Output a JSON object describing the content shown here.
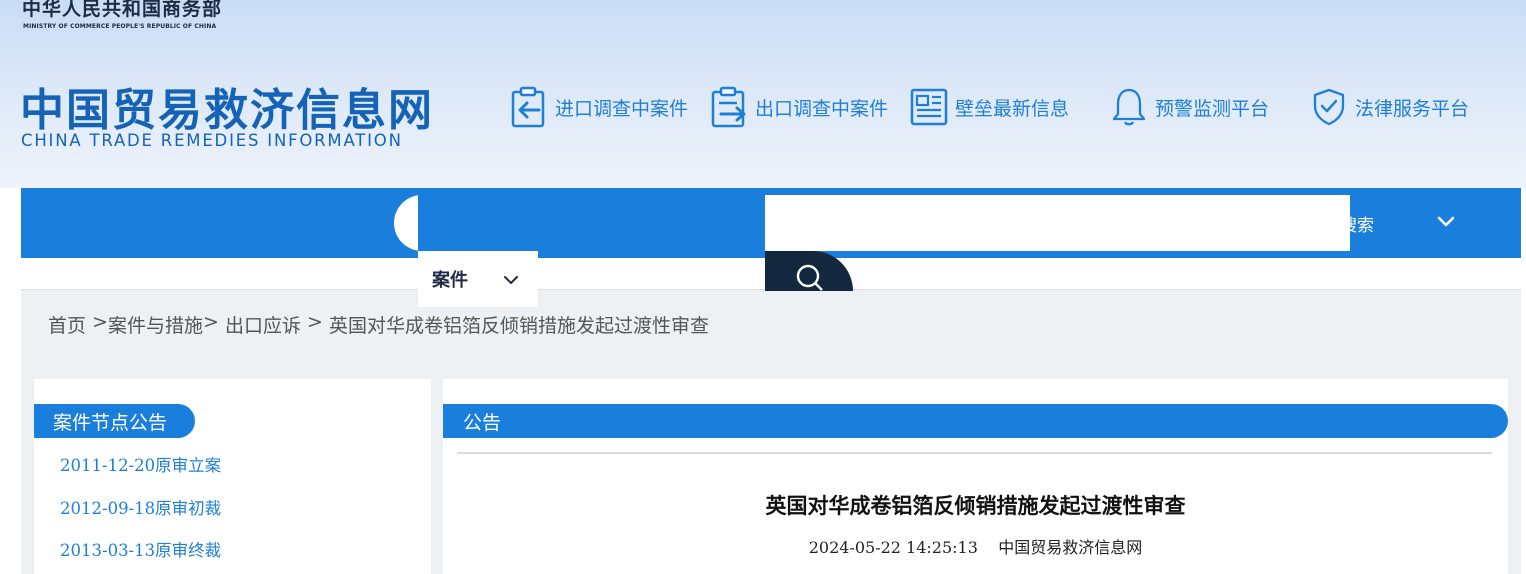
{
  "header": {
    "ministry_cn": "中华人民共和国商务部",
    "ministry_en": "MINISTRY OF COMMERCE PEOPLE'S REPUBLIC OF CHINA",
    "logo_cn": "中国贸易救济信息网",
    "logo_en": "CHINA TRADE REMEDIES INFORMATION",
    "nav": [
      {
        "label": "进口调查中案件",
        "icon": "clipboard-import-icon"
      },
      {
        "label": "出口调查中案件",
        "icon": "clipboard-export-icon"
      },
      {
        "label": "壁垒最新信息",
        "icon": "newspaper-icon"
      },
      {
        "label": "预警监测平台",
        "icon": "bell-icon"
      },
      {
        "label": "法律服务平台",
        "icon": "shield-check-icon"
      }
    ]
  },
  "search": {
    "category": "案件",
    "input_value": "",
    "label_fragment": "搜索"
  },
  "breadcrumb": {
    "items": [
      "首页",
      "案件与措施",
      "出口应诉",
      "英国对华成卷铝箔反倾销措施发起过渡性审查"
    ],
    "separators": [
      " >",
      "> ",
      " > "
    ]
  },
  "sidebar": {
    "title": "案件节点公告",
    "items": [
      "2011-12-20原审立案",
      "2012-09-18原审初裁",
      "2013-03-13原审终裁"
    ]
  },
  "main": {
    "tab": "公告",
    "article_title": "英国对华成卷铝箔反倾销措施发起过渡性审查",
    "date": "2024-05-22 14:25:13",
    "source": "中国贸易救济信息网"
  },
  "colors": {
    "primary": "#1a7fdc",
    "logo": "#1463b6",
    "link": "#1f7fd6",
    "dark_button": "#13283f"
  }
}
